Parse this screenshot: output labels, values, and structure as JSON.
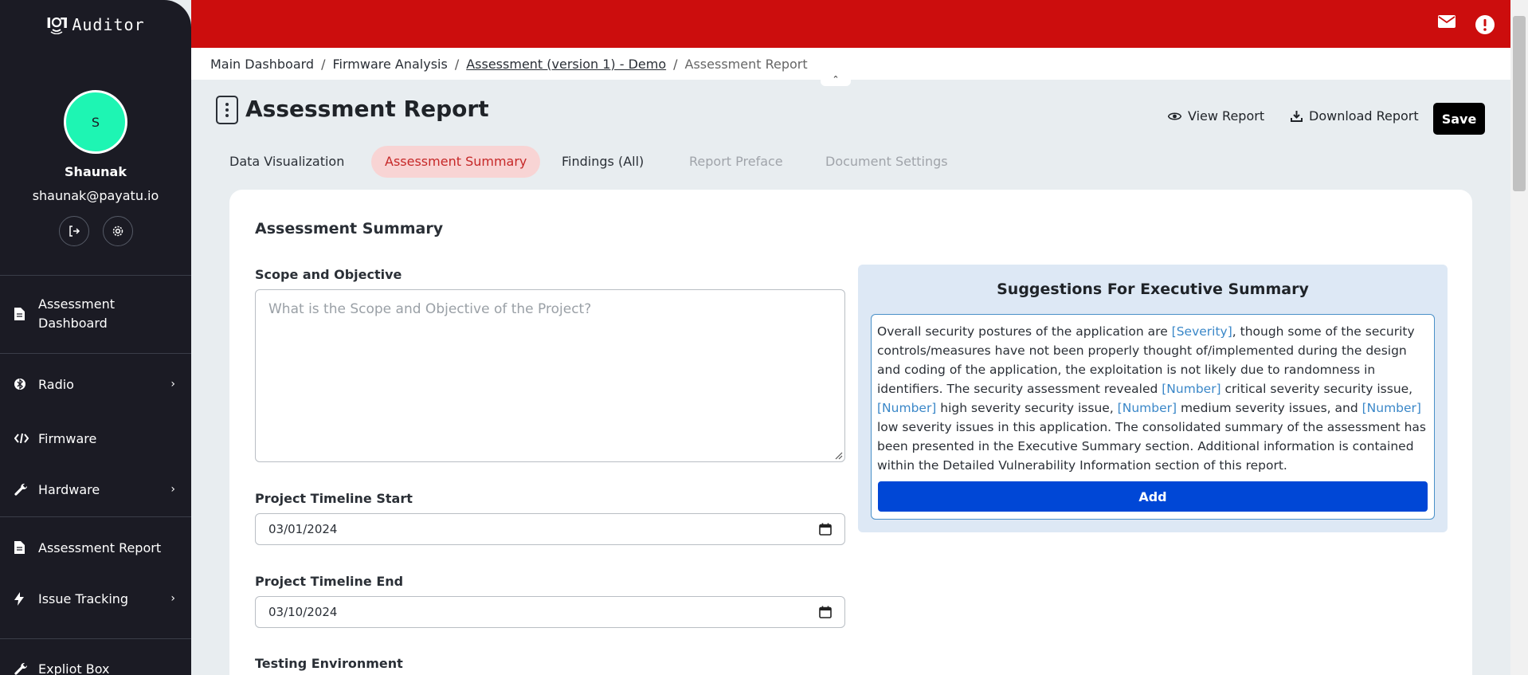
{
  "app": {
    "logo_text": "Auditor",
    "logo_mark": "IoT"
  },
  "user": {
    "initial": "S",
    "name": "Shaunak",
    "email": "shaunak@payatu.io"
  },
  "sidebar": {
    "items": [
      {
        "label_line1": "Assessment",
        "label_line2": "Dashboard",
        "icon": "file-icon"
      },
      {
        "label": "Radio",
        "icon": "bluetooth-icon",
        "has_submenu": true
      },
      {
        "label": "Firmware",
        "icon": "code-icon",
        "has_submenu": false
      },
      {
        "label": "Hardware",
        "icon": "wrench-icon",
        "has_submenu": true
      },
      {
        "label": "Assessment Report",
        "icon": "file-icon",
        "has_submenu": false
      },
      {
        "label": "Issue Tracking",
        "icon": "bolt-icon",
        "has_submenu": true
      },
      {
        "label": "Expliot Box",
        "icon": "wrench-icon",
        "has_submenu": false
      }
    ]
  },
  "breadcrumb": {
    "items": [
      "Main Dashboard",
      "Firmware Analysis",
      "Assessment (version 1) - Demo",
      "Assessment Report"
    ]
  },
  "header": {
    "title": "Assessment Report",
    "view_report": "View Report",
    "download_report": "Download Report",
    "save": "Save"
  },
  "tabs": [
    {
      "label": "Data Visualization",
      "state": "normal"
    },
    {
      "label": "Assessment Summary",
      "state": "active"
    },
    {
      "label": "Findings (All)",
      "state": "normal"
    },
    {
      "label": "Report Preface",
      "state": "disabled"
    },
    {
      "label": "Document Settings",
      "state": "disabled"
    }
  ],
  "form": {
    "section_title": "Assessment Summary",
    "scope_label": "Scope and Objective",
    "scope_placeholder": "What is the Scope and Objective of the Project?",
    "start_label": "Project Timeline Start",
    "start_value": "03/01/2024",
    "end_label": "Project Timeline End",
    "end_value": "03/10/2024",
    "env_label": "Testing Environment"
  },
  "suggestions": {
    "title": "Suggestions For Executive Summary",
    "t1": "Overall security postures of the application are ",
    "p_severity": "[Severity]",
    "t2": ", though some of the security controls/measures have not been properly thought of/implemented during the design and coding of the application, the exploitation is not likely due to randomness in identifiers. The security assessment revealed ",
    "p_number1": "[Number]",
    "t3": " critical severity security issue, ",
    "p_number2": "[Number]",
    "t4": " high severity security issue, ",
    "p_number3": "[Number]",
    "t5": " medium severity issues, and ",
    "p_number4": "[Number]",
    "t6": " low severity issues in this application. The consolidated summary of the assessment has been presented in the Executive Summary section. Additional information is contained within the Detailed Vulnerability Information section of this report.",
    "add_label": "Add"
  },
  "colors": {
    "topbar": "#cc0d0d",
    "sidebar": "#1b1b24",
    "avatar": "#1ef5b3",
    "add_button": "#0047d6",
    "placeholder_link": "#3a87c8"
  }
}
